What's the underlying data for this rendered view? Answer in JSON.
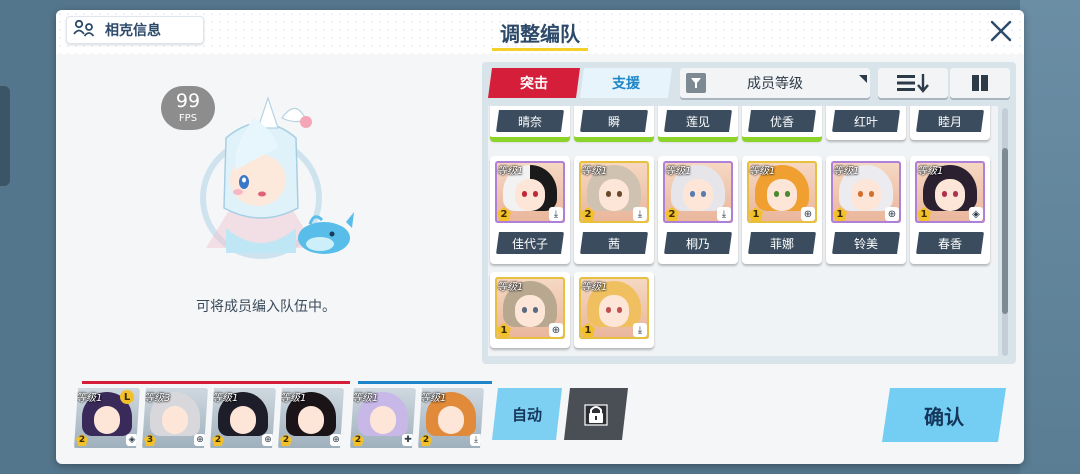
{
  "header": {
    "counter_label": "相克信息",
    "title": "调整编队"
  },
  "left": {
    "fps_value": "99",
    "fps_unit": "FPS",
    "hint": "可将成员编入队伍中。"
  },
  "filter": {
    "tab_striker": "突击",
    "tab_special": "支援",
    "sort_label": "成员等级"
  },
  "list": {
    "top_row": [
      {
        "name": "晴奈",
        "highlight": true
      },
      {
        "name": "瞬",
        "highlight": true
      },
      {
        "name": "莲见",
        "highlight": true
      },
      {
        "name": "优香",
        "highlight": true
      },
      {
        "name": "红叶",
        "highlight": false
      },
      {
        "name": "睦月",
        "highlight": false
      }
    ],
    "mid_row": [
      {
        "name": "佳代子",
        "level": "等级1",
        "star": "2",
        "role": "download-icon",
        "hair": "#f2f2f2",
        "hair2": "#1a1a1a",
        "eye": "#c0283a",
        "border": "purple"
      },
      {
        "name": "茜",
        "level": "等级1",
        "star": "2",
        "role": "download-icon",
        "hair": "#cfc2b0",
        "hair2": "#cfc2b0",
        "eye": "#6a4a2a",
        "border": "gold"
      },
      {
        "name": "桐乃",
        "level": "等级1",
        "star": "2",
        "role": "download-icon",
        "hair": "#e6e6ea",
        "hair2": "#e6e6ea",
        "eye": "#5a7ab0",
        "border": "purple"
      },
      {
        "name": "菲娜",
        "level": "等级1",
        "star": "1",
        "role": "crosshair-icon",
        "hair": "#f0a030",
        "hair2": "#f0a030",
        "eye": "#4a8a30",
        "border": "gold"
      },
      {
        "name": "铃美",
        "level": "等级1",
        "star": "1",
        "role": "crosshair-icon",
        "hair": "#ececf0",
        "hair2": "#ececf0",
        "eye": "#d07030",
        "border": "purple"
      },
      {
        "name": "春香",
        "level": "等级1",
        "star": "1",
        "role": "shield-icon",
        "hair": "#2a2030",
        "hair2": "#2a2030",
        "eye": "#b03050",
        "border": "purple"
      }
    ],
    "bottom_row": [
      {
        "level": "等级1",
        "star": "1",
        "role": "crosshair-icon",
        "hair": "#b8a890",
        "eye": "#5a6a80",
        "border": "gold"
      },
      {
        "level": "等级1",
        "star": "1",
        "role": "download-icon",
        "hair": "#f0c060",
        "eye": "#c05050",
        "border": "gold"
      }
    ]
  },
  "team": {
    "striker_slots": [
      {
        "level": "等级1",
        "star": "2",
        "role": "shield-icon",
        "hair": "#3a2a5a",
        "badge": "L"
      },
      {
        "level": "等级3",
        "star": "3",
        "role": "crosshair-icon",
        "hair": "#d8d8dc"
      },
      {
        "level": "等级1",
        "star": "2",
        "role": "crosshair-icon",
        "hair": "#1e1e2a"
      },
      {
        "level": "等级1",
        "star": "2",
        "role": "crosshair-icon",
        "hair": "#1a1418"
      }
    ],
    "special_slots": [
      {
        "level": "等级1",
        "star": "2",
        "role": "plus-shield-icon",
        "hair": "#c8b8e8"
      },
      {
        "level": "等级1",
        "star": "2",
        "role": "download-icon",
        "hair": "#e08a3a"
      }
    ],
    "auto_label": "自动",
    "confirm_label": "确认"
  },
  "colors": {
    "striker": "#d51e3a",
    "special": "#1d86c8",
    "accent_yellow": "#f5d02a"
  }
}
